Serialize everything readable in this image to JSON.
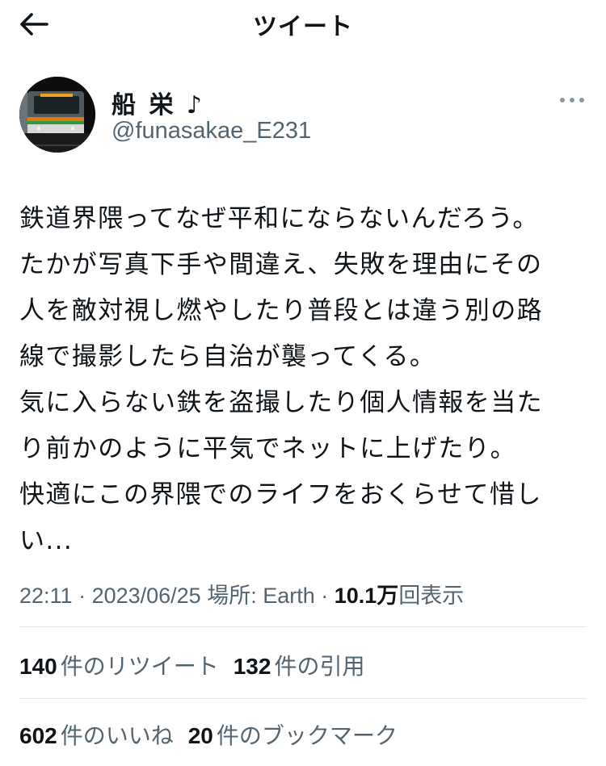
{
  "header": {
    "title": "ツイート",
    "back_icon": "arrow-left-icon"
  },
  "author": {
    "display_name": "船 栄 ♪",
    "handle": "@funasakae_E231"
  },
  "tweet": {
    "text": "鉄道界隈ってなぜ平和にならないんだろう。\nたかが写真下手や間違え、失敗を理由にその\n人を敵対視し燃やしたり普段とは違う別の路\n線で撮影したら自治が襲ってくる。\n気に入らない鉄を盗撮したり個人情報を当た\nり前かのように平気でネットに上げたり。\n快適にこの界隈でのライフをおくらせて惜し\nい..."
  },
  "meta": {
    "time": "22:11",
    "sep1": " · ",
    "date": "2023/06/25",
    "location": " 場所: Earth",
    "sep2": " · ",
    "views_count": "10.1万",
    "views_label": "回表示"
  },
  "stats": {
    "retweets_count": "140",
    "retweets_label": "件のリツイート",
    "quotes_count": "132",
    "quotes_label": "件の引用",
    "likes_count": "602",
    "likes_label": "件のいいね",
    "bookmarks_count": "20",
    "bookmarks_label": "件のブックマーク"
  },
  "colors": {
    "text_primary": "#0f1419",
    "text_secondary": "#536471",
    "divider": "#e6e9eb"
  }
}
